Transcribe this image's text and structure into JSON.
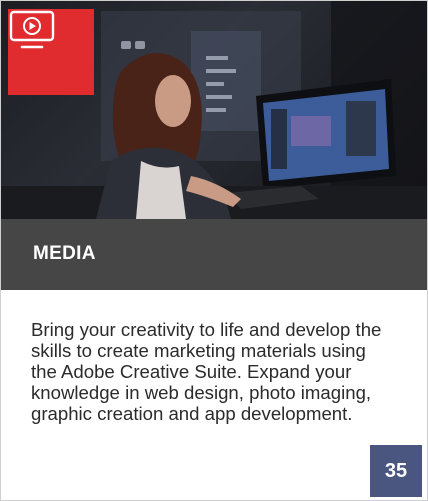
{
  "card": {
    "category_icon": "monitor-play-icon",
    "title": "MEDIA",
    "description": "Bring your creativity to life and develop the skills to create marketing materials using the Adobe Creative Suite. Expand your knowledge in web design, photo imaging, graphic creation and app development.",
    "page_number": "35"
  },
  "colors": {
    "badge": "#e02b2f",
    "title_bar": "#464646",
    "page_number_bg": "#4a5580"
  }
}
